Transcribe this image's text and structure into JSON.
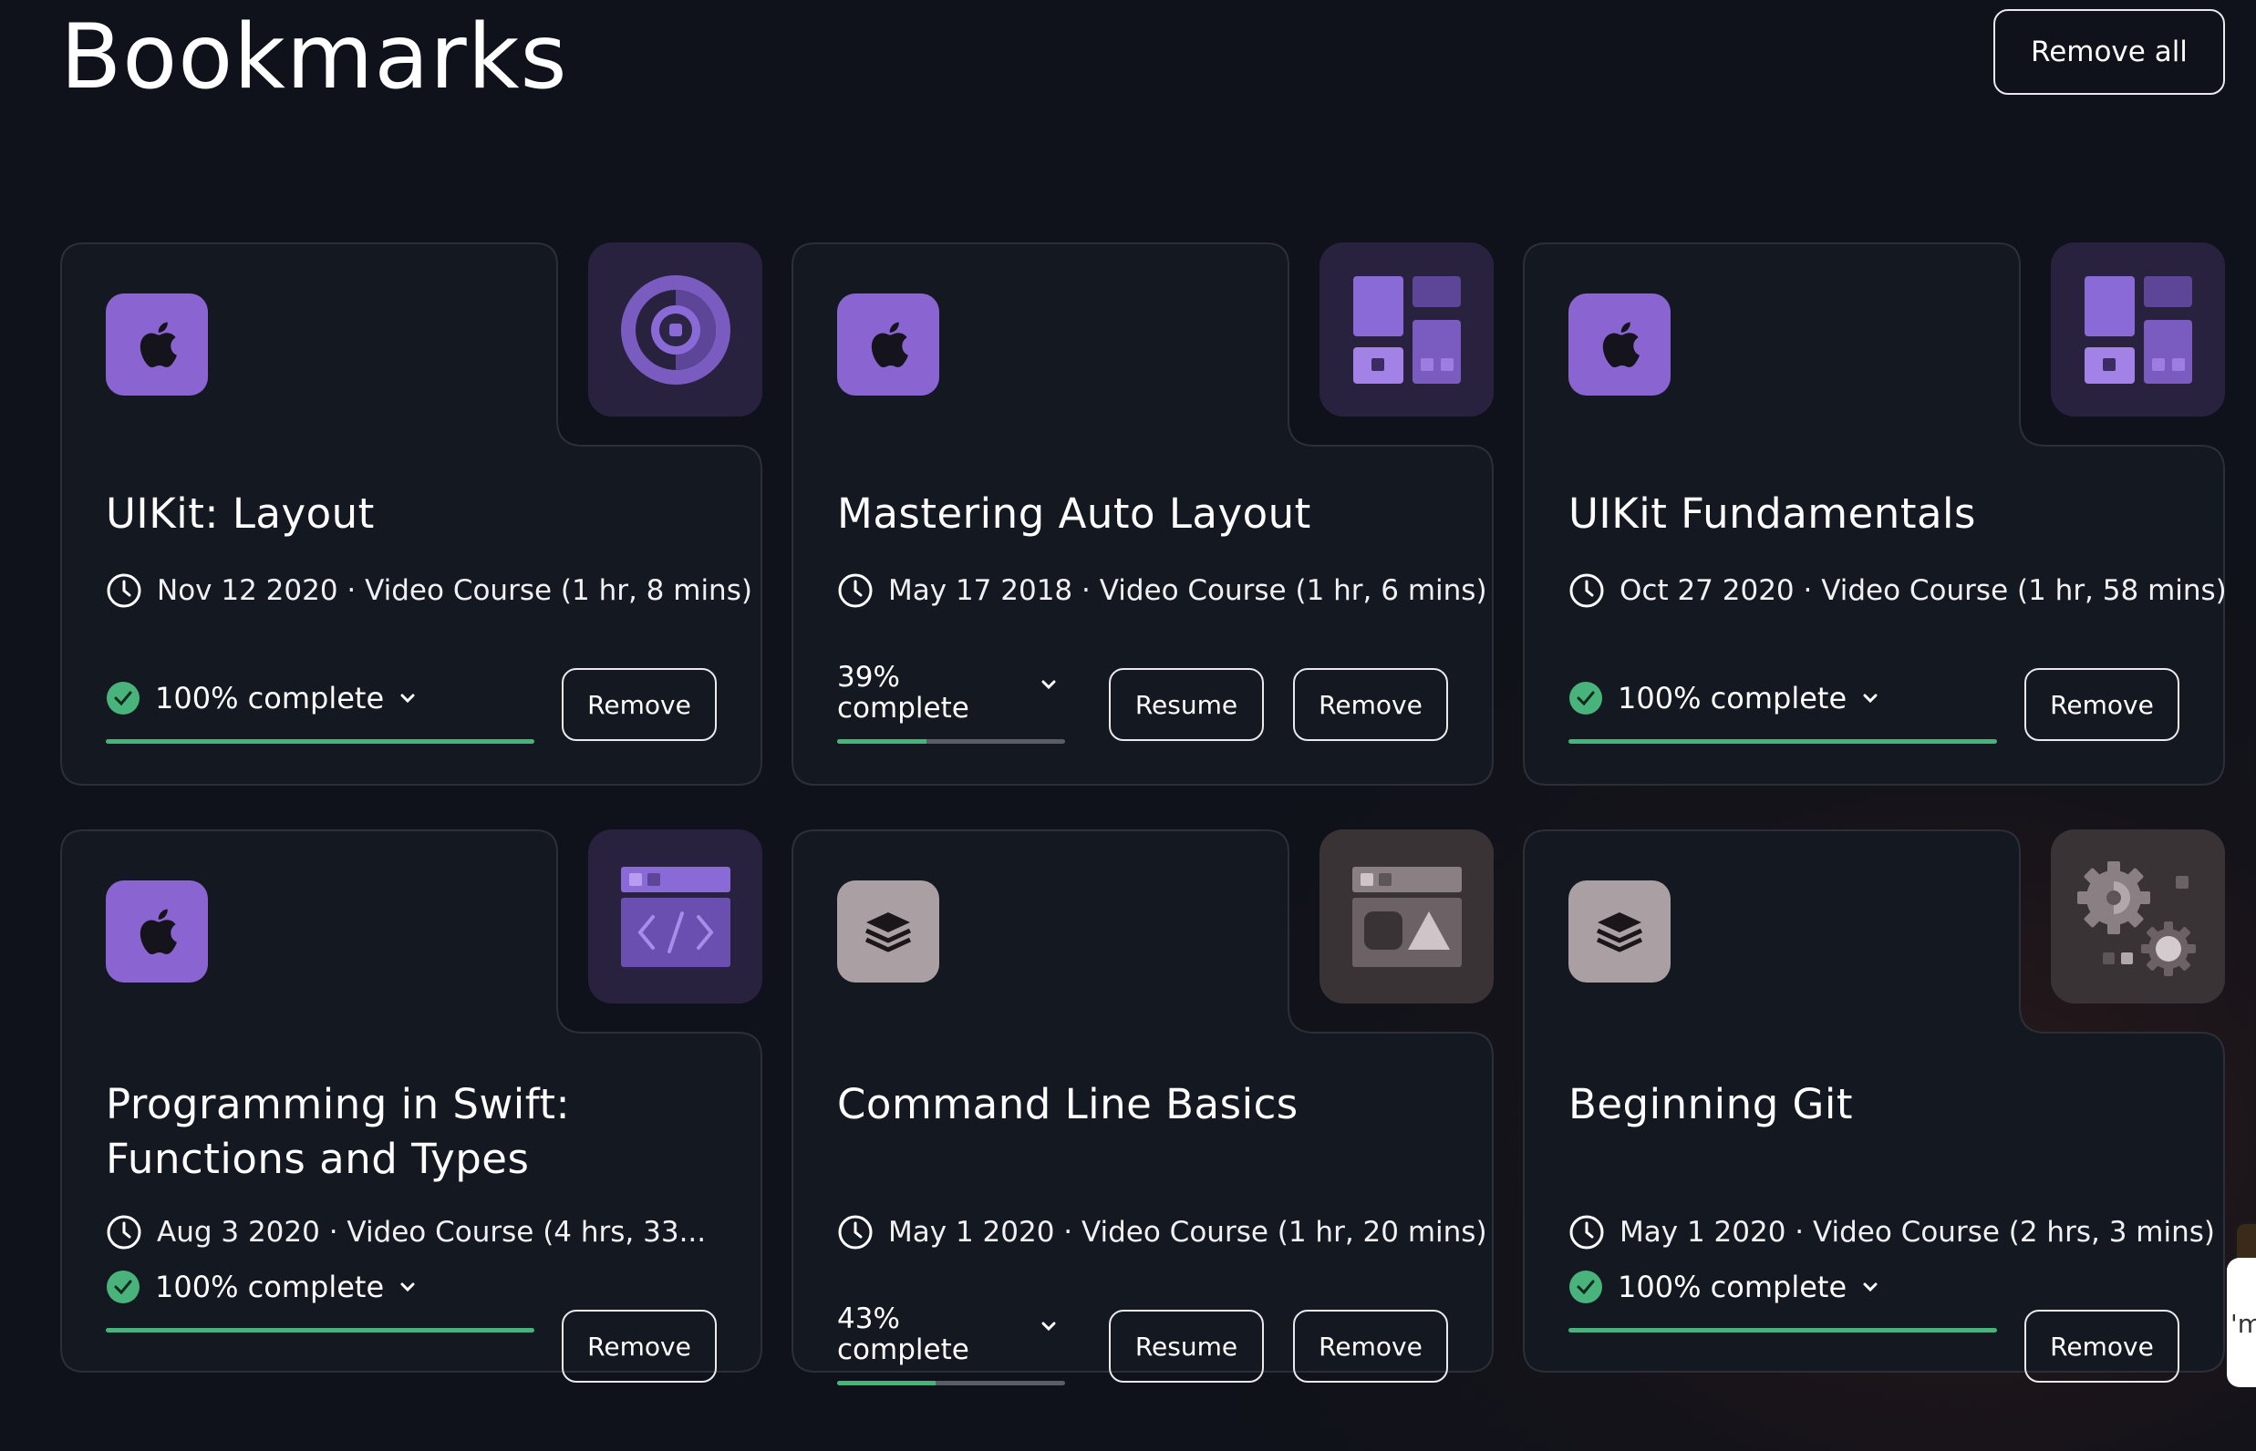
{
  "header": {
    "title": "Bookmarks",
    "remove_all_label": "Remove all"
  },
  "colors": {
    "background": "#0f121a",
    "card": "#141821",
    "accent_violet": "#8a65d1",
    "complete_green": "#49b37c"
  },
  "cards": [
    {
      "title": "UIKit: Layout",
      "meta": "Nov 12 2020 · Video Course (1 hr, 8 mins)",
      "platform_icon": "apple-icon",
      "thumbnail_icon": "circle-target-icon",
      "status": "complete",
      "progress_text": "100% complete",
      "progress": 1.0,
      "remove_label": "Remove"
    },
    {
      "title": "Mastering Auto Layout",
      "meta": "May 17 2018 · Video Course (1 hr, 6 mins)",
      "platform_icon": "apple-icon",
      "thumbnail_icon": "layout-grid-icon",
      "status": "in-progress",
      "progress_percent": "39%",
      "progress_word": "complete",
      "progress": 0.39,
      "resume_label": "Resume",
      "remove_label": "Remove"
    },
    {
      "title": "UIKit Fundamentals",
      "meta": "Oct 27 2020 · Video Course (1 hr, 58 mins)",
      "platform_icon": "apple-icon",
      "thumbnail_icon": "layout-grid-icon",
      "status": "complete",
      "progress_text": "100% complete",
      "progress": 1.0,
      "remove_label": "Remove"
    },
    {
      "title_line1": "Programming in Swift:",
      "title_line2": "Functions and Types",
      "meta": "Aug 3 2020 · Video Course (4 hrs, 33...",
      "platform_icon": "apple-icon",
      "thumbnail_icon": "code-window-icon",
      "status": "complete",
      "progress_text": "100% complete",
      "progress": 1.0,
      "remove_label": "Remove"
    },
    {
      "title": "Command Line Basics",
      "meta": "May 1 2020 · Video Course (1 hr, 20 mins)",
      "platform_icon": "layers-icon",
      "thumbnail_icon": "image-window-icon",
      "status": "in-progress",
      "progress_percent": "43%",
      "progress_word": "complete",
      "progress": 0.43,
      "resume_label": "Resume",
      "remove_label": "Remove"
    },
    {
      "title": "Beginning Git",
      "meta": "May 1 2020 · Video Course (2 hrs, 3 mins)",
      "platform_icon": "layers-icon",
      "thumbnail_icon": "gears-icon",
      "status": "complete",
      "progress_text": "100% complete",
      "progress": 1.0,
      "remove_label": "Remove"
    }
  ],
  "edge_chip_text": "'m"
}
